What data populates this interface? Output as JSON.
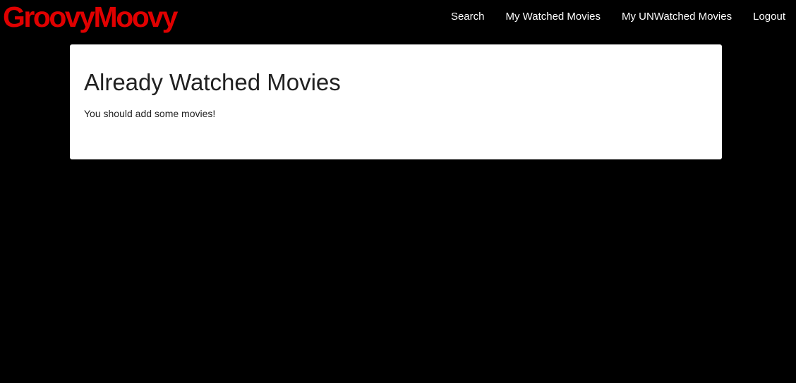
{
  "navbar": {
    "brand": "GroovyMoovy",
    "links": [
      {
        "label": "Search"
      },
      {
        "label": "My Watched Movies"
      },
      {
        "label": "My UNWatched Movies"
      },
      {
        "label": "Logout"
      }
    ]
  },
  "main": {
    "title": "Already Watched Movies",
    "message": "You should add some movies!"
  },
  "colors": {
    "background": "#000000",
    "brand": "#e00000",
    "nav_text": "#ffffff",
    "card_background": "#ffffff",
    "card_text": "#212121"
  }
}
